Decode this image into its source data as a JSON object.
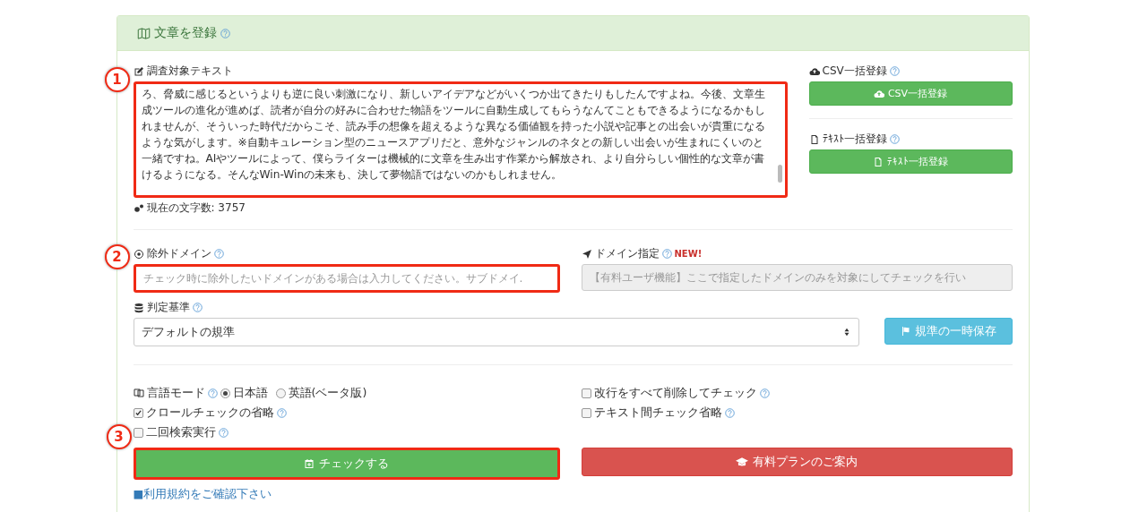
{
  "panel": {
    "title": "文章を登録"
  },
  "target_text": {
    "label": "調査対象テキスト",
    "value": "ろ、脅威に感じるというよりも逆に良い刺激になり、新しいアイデアなどがいくつか出てきたりもしたんですよね。今後、文章生成ツールの進化が進めば、読者が自分の好みに合わせた物語をツールに自動生成してもらうなんてこともできるようになるかもしれませんが、そういった時代だからこそ、読み手の想像を超えるような異なる価値観を持った小説や記事との出会いが貴重になるような気がします。※自動キュレーション型のニュースアプリだと、意外なジャンルのネタとの新しい出会いが生まれにくいのと一緒ですね。AIやツールによって、僕らライターは機械的に文章を生み出す作業から解放され、より自分らしい個性的な文章が書けるようになる。そんなWin-Winの未来も、決して夢物語ではないのかもしれません。",
    "char_count": "現在の文字数: 3757",
    "marker": "1"
  },
  "bulk": [
    {
      "label": "CSV一括登録",
      "button": "CSV一括登録",
      "kind": "csv"
    },
    {
      "label": "ﾃｷｽﾄ一括登録",
      "button": "ﾃｷｽﾄ一括登録",
      "kind": "text"
    }
  ],
  "exclude_domain": {
    "label": "除外ドメイン",
    "placeholder": "チェック時に除外したいドメインがある場合は入力してください。サブドメイ.",
    "marker": "2"
  },
  "domain_spec": {
    "label": "ドメイン指定",
    "badge": "NEW!",
    "placeholder": "【有料ユーザ機能】ここで指定したドメインのみを対象にしてチェックを行い",
    "disabled": true
  },
  "criteria": {
    "label": "判定基準",
    "value": "デフォルトの規準",
    "save_button": "規準の一時保存"
  },
  "language": {
    "label": "言語モード",
    "options": [
      {
        "label": "日本語",
        "selected": true
      },
      {
        "label": "英語(ベータ版)",
        "selected": false
      }
    ]
  },
  "options": [
    {
      "label": "改行をすべて削除してチェック",
      "checked": false
    },
    {
      "label": "クロールチェックの省略",
      "checked": true
    },
    {
      "label": "テキスト間チェック省略",
      "checked": false
    },
    {
      "label": "二回検索実行",
      "checked": false
    }
  ],
  "check_button": {
    "label": "チェックする",
    "marker": "3"
  },
  "plan_button": {
    "label": "有料プランのご案内"
  },
  "terms_link": "■利用規約をご確認下さい"
}
